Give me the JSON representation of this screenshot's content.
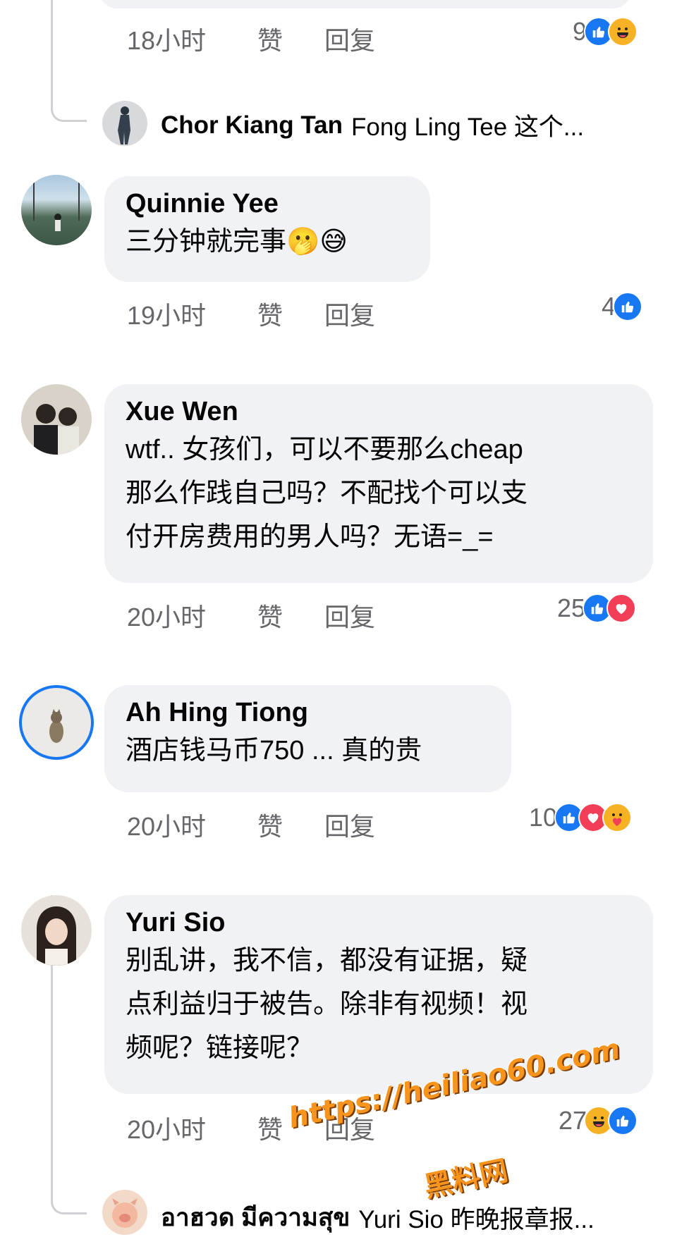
{
  "comments": [
    {
      "time": "18小时",
      "like": "赞",
      "reply": "回复",
      "count": "9",
      "reactions": [
        "like",
        "haha"
      ]
    },
    {
      "name": "Quinnie Yee",
      "text": "三分钟就完事🫢😅",
      "time": "19小时",
      "like": "赞",
      "reply": "回复",
      "count": "4",
      "reactions": [
        "like"
      ]
    },
    {
      "name": "Xue Wen",
      "text": "wtf.. 女孩们，可以不要那么cheap\n那么作践自己吗？不配找个可以支\n付开房费用的男人吗？无语=_=",
      "time": "20小时",
      "like": "赞",
      "reply": "回复",
      "count": "25",
      "reactions": [
        "like",
        "love"
      ]
    },
    {
      "name": "Ah Hing Tiong",
      "text": "酒店钱马币750 ... 真的贵",
      "time": "20小时",
      "like": "赞",
      "reply": "回复",
      "count": "10",
      "reactions": [
        "like",
        "love",
        "care"
      ]
    },
    {
      "name": "Yuri Sio",
      "text": "别乱讲，我不信，都没有证据，疑\n点利益归于被告。除非有视频！视\n频呢？链接呢？",
      "time": "20小时",
      "like": "赞",
      "reply": "回复",
      "count": "27",
      "reactions": [
        "haha",
        "like"
      ]
    }
  ],
  "replies": [
    {
      "name": "Chor Kiang Tan",
      "text": "Fong Ling Tee 这个..."
    },
    {
      "name": "อาฮวด มีความสุข",
      "text": "Yuri Sio 昨晚报章报..."
    }
  ],
  "watermark": {
    "url": "https://heiliao60.com",
    "label": "黑料网"
  },
  "colors": {
    "like": "#1877f2",
    "love": "#f33e58",
    "haha": "#f7b125",
    "bubble": "#f0f2f5",
    "meta": "#65676b"
  }
}
